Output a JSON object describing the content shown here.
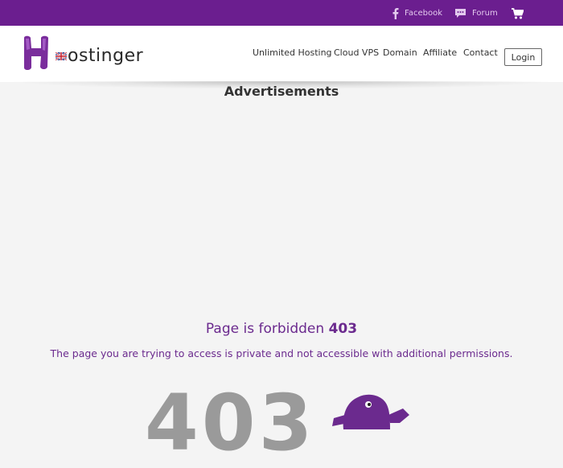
{
  "topbar": {
    "facebook_label": "Facebook",
    "forum_label": "Forum",
    "icons": [
      "facebook-icon",
      "chat-icon",
      "cart-icon"
    ]
  },
  "header": {
    "logo_text": "ostinger",
    "nav": [
      {
        "label": "Unlimited Hosting"
      },
      {
        "label": "Cloud VPS"
      },
      {
        "label": "Domain"
      },
      {
        "label": "Affiliate"
      },
      {
        "label": "Contact"
      }
    ],
    "login_label": "Login"
  },
  "main": {
    "ads_title": "Advertisements",
    "error_title_prefix": "Page is forbidden ",
    "error_code": "403",
    "error_description": "The page you are trying to access is private and not accessible with additional permissions.",
    "big_code": "403"
  },
  "colors": {
    "brand_purple": "#6b1e8f",
    "text_purple": "#6b2a8e",
    "background": "#f4f4f4"
  }
}
